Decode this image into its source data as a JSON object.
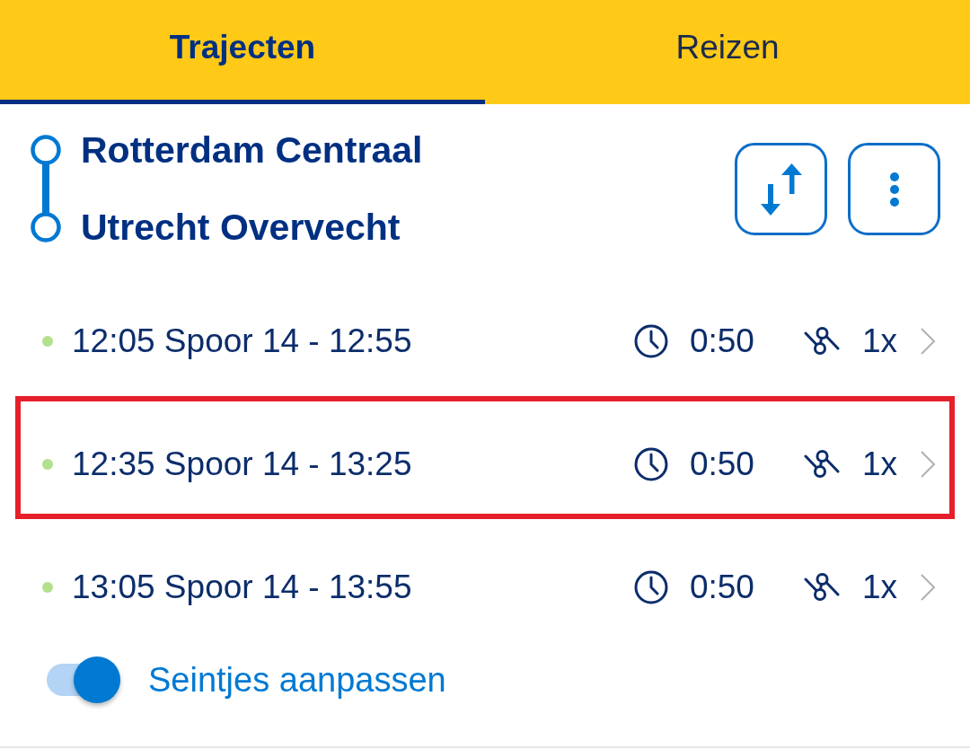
{
  "tabs": [
    {
      "label": "Trajecten",
      "selected": true
    },
    {
      "label": "Reizen",
      "selected": false
    }
  ],
  "route": {
    "from": "Rotterdam Centraal",
    "to": "Utrecht Overvecht"
  },
  "trips": [
    {
      "summary": "12:05 Spoor 14 - 12:55",
      "color": "#b3e08c",
      "duration": "0:50",
      "transfers": "1x",
      "highlighted": false
    },
    {
      "summary": "12:35 Spoor 14 - 13:25",
      "color": "#b3e08c",
      "duration": "0:50",
      "transfers": "1x",
      "highlighted": true
    },
    {
      "summary": "13:05 Spoor 14 - 13:55",
      "color": "#b3e08c",
      "duration": "0:50",
      "transfers": "1x",
      "highlighted": false
    }
  ],
  "toggle": {
    "label": "Seintjes aanpassen",
    "on": true
  }
}
